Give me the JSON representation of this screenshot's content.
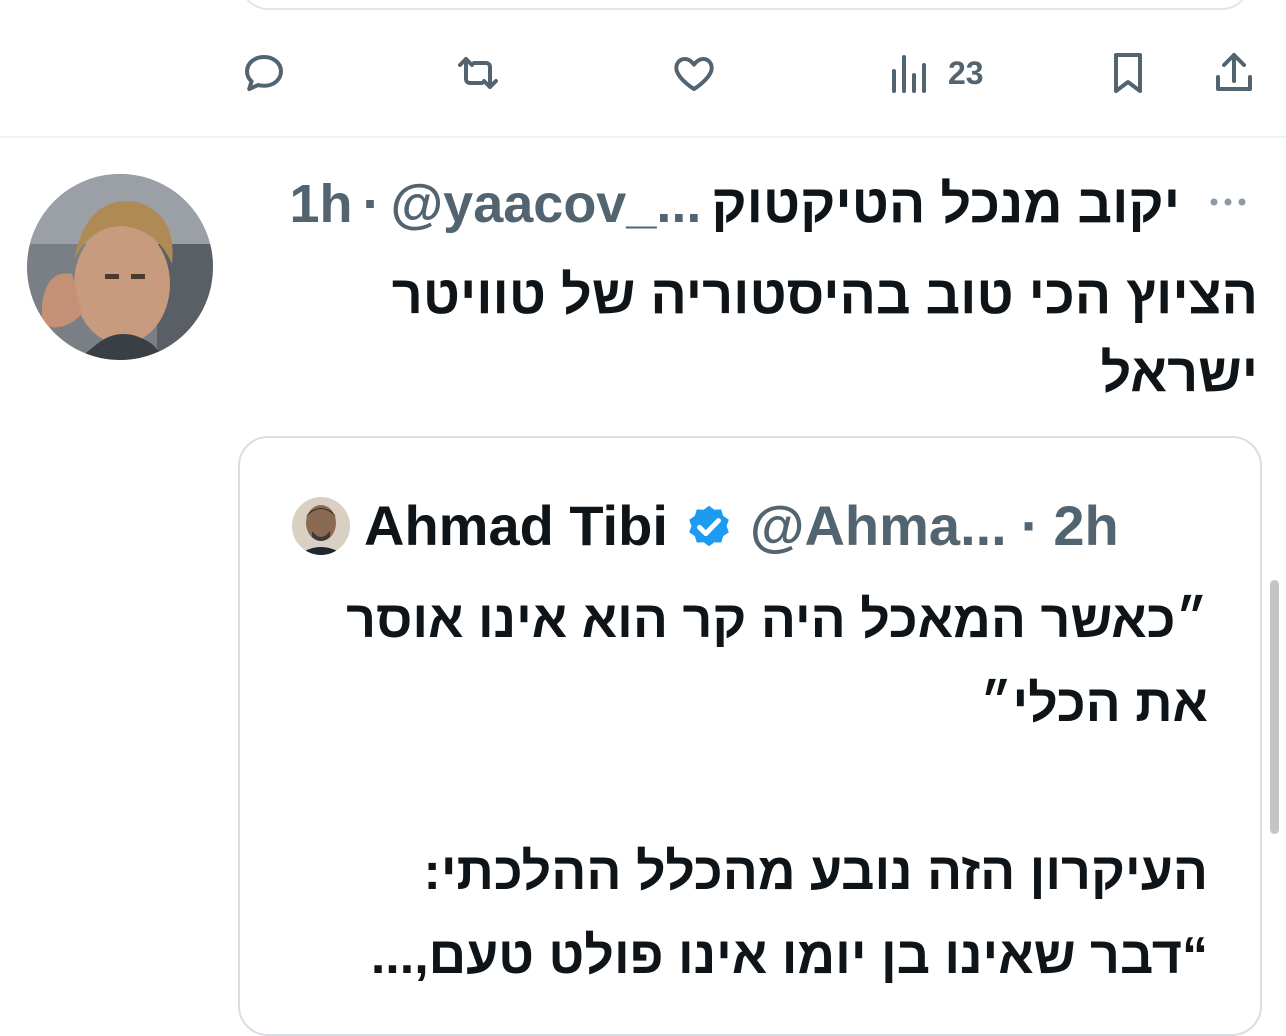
{
  "actions": {
    "reply_icon": "reply-icon",
    "retweet_icon": "retweet-icon",
    "like_icon": "like-icon",
    "views_icon": "views-icon",
    "views_count": "23",
    "bookmark_icon": "bookmark-icon",
    "share_icon": "share-icon"
  },
  "tweet": {
    "author_name": "יקוב מנכל הטיקטוק",
    "handle": "@yaacov_...",
    "separator": "·",
    "time": "1h",
    "more_icon": "more-icon",
    "text": "הציוץ הכי טוב בהיסטוריה של טוויטר ישראל"
  },
  "quoted": {
    "author_name": "Ahmad Tibi",
    "handle": "@Ahma...",
    "separator": "·",
    "time": "2h",
    "text": "״כאשר המאכל היה קר הוא אינו אוסר את הכלי״\n\nהעיקרון הזה נובע מהכלל ההלכתי:\n“דבר שאינו בן יומו אינו פולט טעם,..."
  },
  "colors": {
    "accent": "#1d9bf0",
    "secondary_text": "#536471",
    "primary_text": "#0f1419"
  }
}
